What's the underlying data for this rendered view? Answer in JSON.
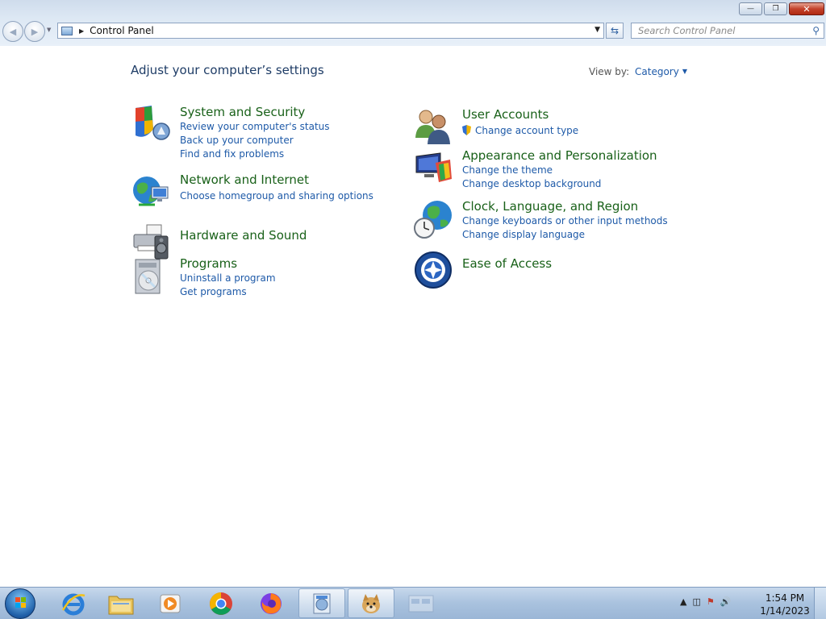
{
  "window": {
    "address": "Control Panel",
    "search_placeholder": "Search Control Panel",
    "buttons": {
      "minimize": "—",
      "restore": "❐",
      "close": "✕"
    }
  },
  "header": {
    "title": "Adjust your computer’s settings",
    "view_by_label": "View by:",
    "view_by_value": "Category"
  },
  "categories_left": [
    {
      "title": "System and Security",
      "icon": "shield-icon",
      "links": [
        "Review your computer's status",
        "Back up your computer",
        "Find and fix problems"
      ]
    },
    {
      "title": "Network and Internet",
      "icon": "globe-network-icon",
      "links": [
        "Choose homegroup and sharing options"
      ]
    },
    {
      "title": "Hardware and Sound",
      "icon": "printer-speaker-icon",
      "links": []
    },
    {
      "title": "Programs",
      "icon": "programs-disc-icon",
      "links": [
        "Uninstall a program",
        "Get programs"
      ]
    }
  ],
  "categories_right": [
    {
      "title": "User Accounts",
      "icon": "users-icon",
      "links": [
        "Change account type"
      ]
    },
    {
      "title": "Appearance and Personalization",
      "icon": "monitor-palette-icon",
      "links": [
        "Change the theme",
        "Change desktop background"
      ]
    },
    {
      "title": "Clock, Language, and Region",
      "icon": "globe-clock-icon",
      "links": [
        "Change keyboards or other input methods",
        "Change display language"
      ]
    },
    {
      "title": "Ease of Access",
      "icon": "ease-of-access-icon",
      "links": []
    }
  ],
  "taskbar": {
    "items": [
      "internet-explorer-icon",
      "file-explorer-icon",
      "media-player-icon",
      "chrome-icon",
      "firefox-icon",
      "control-panel-icon",
      "doge-image-icon",
      "window-thumbnail-icon"
    ],
    "time": "1:54 PM",
    "date": "1/14/2023"
  },
  "colors": {
    "title_green": "#196119",
    "link_blue": "#1e5aa8",
    "heading": "#1e3c66"
  }
}
